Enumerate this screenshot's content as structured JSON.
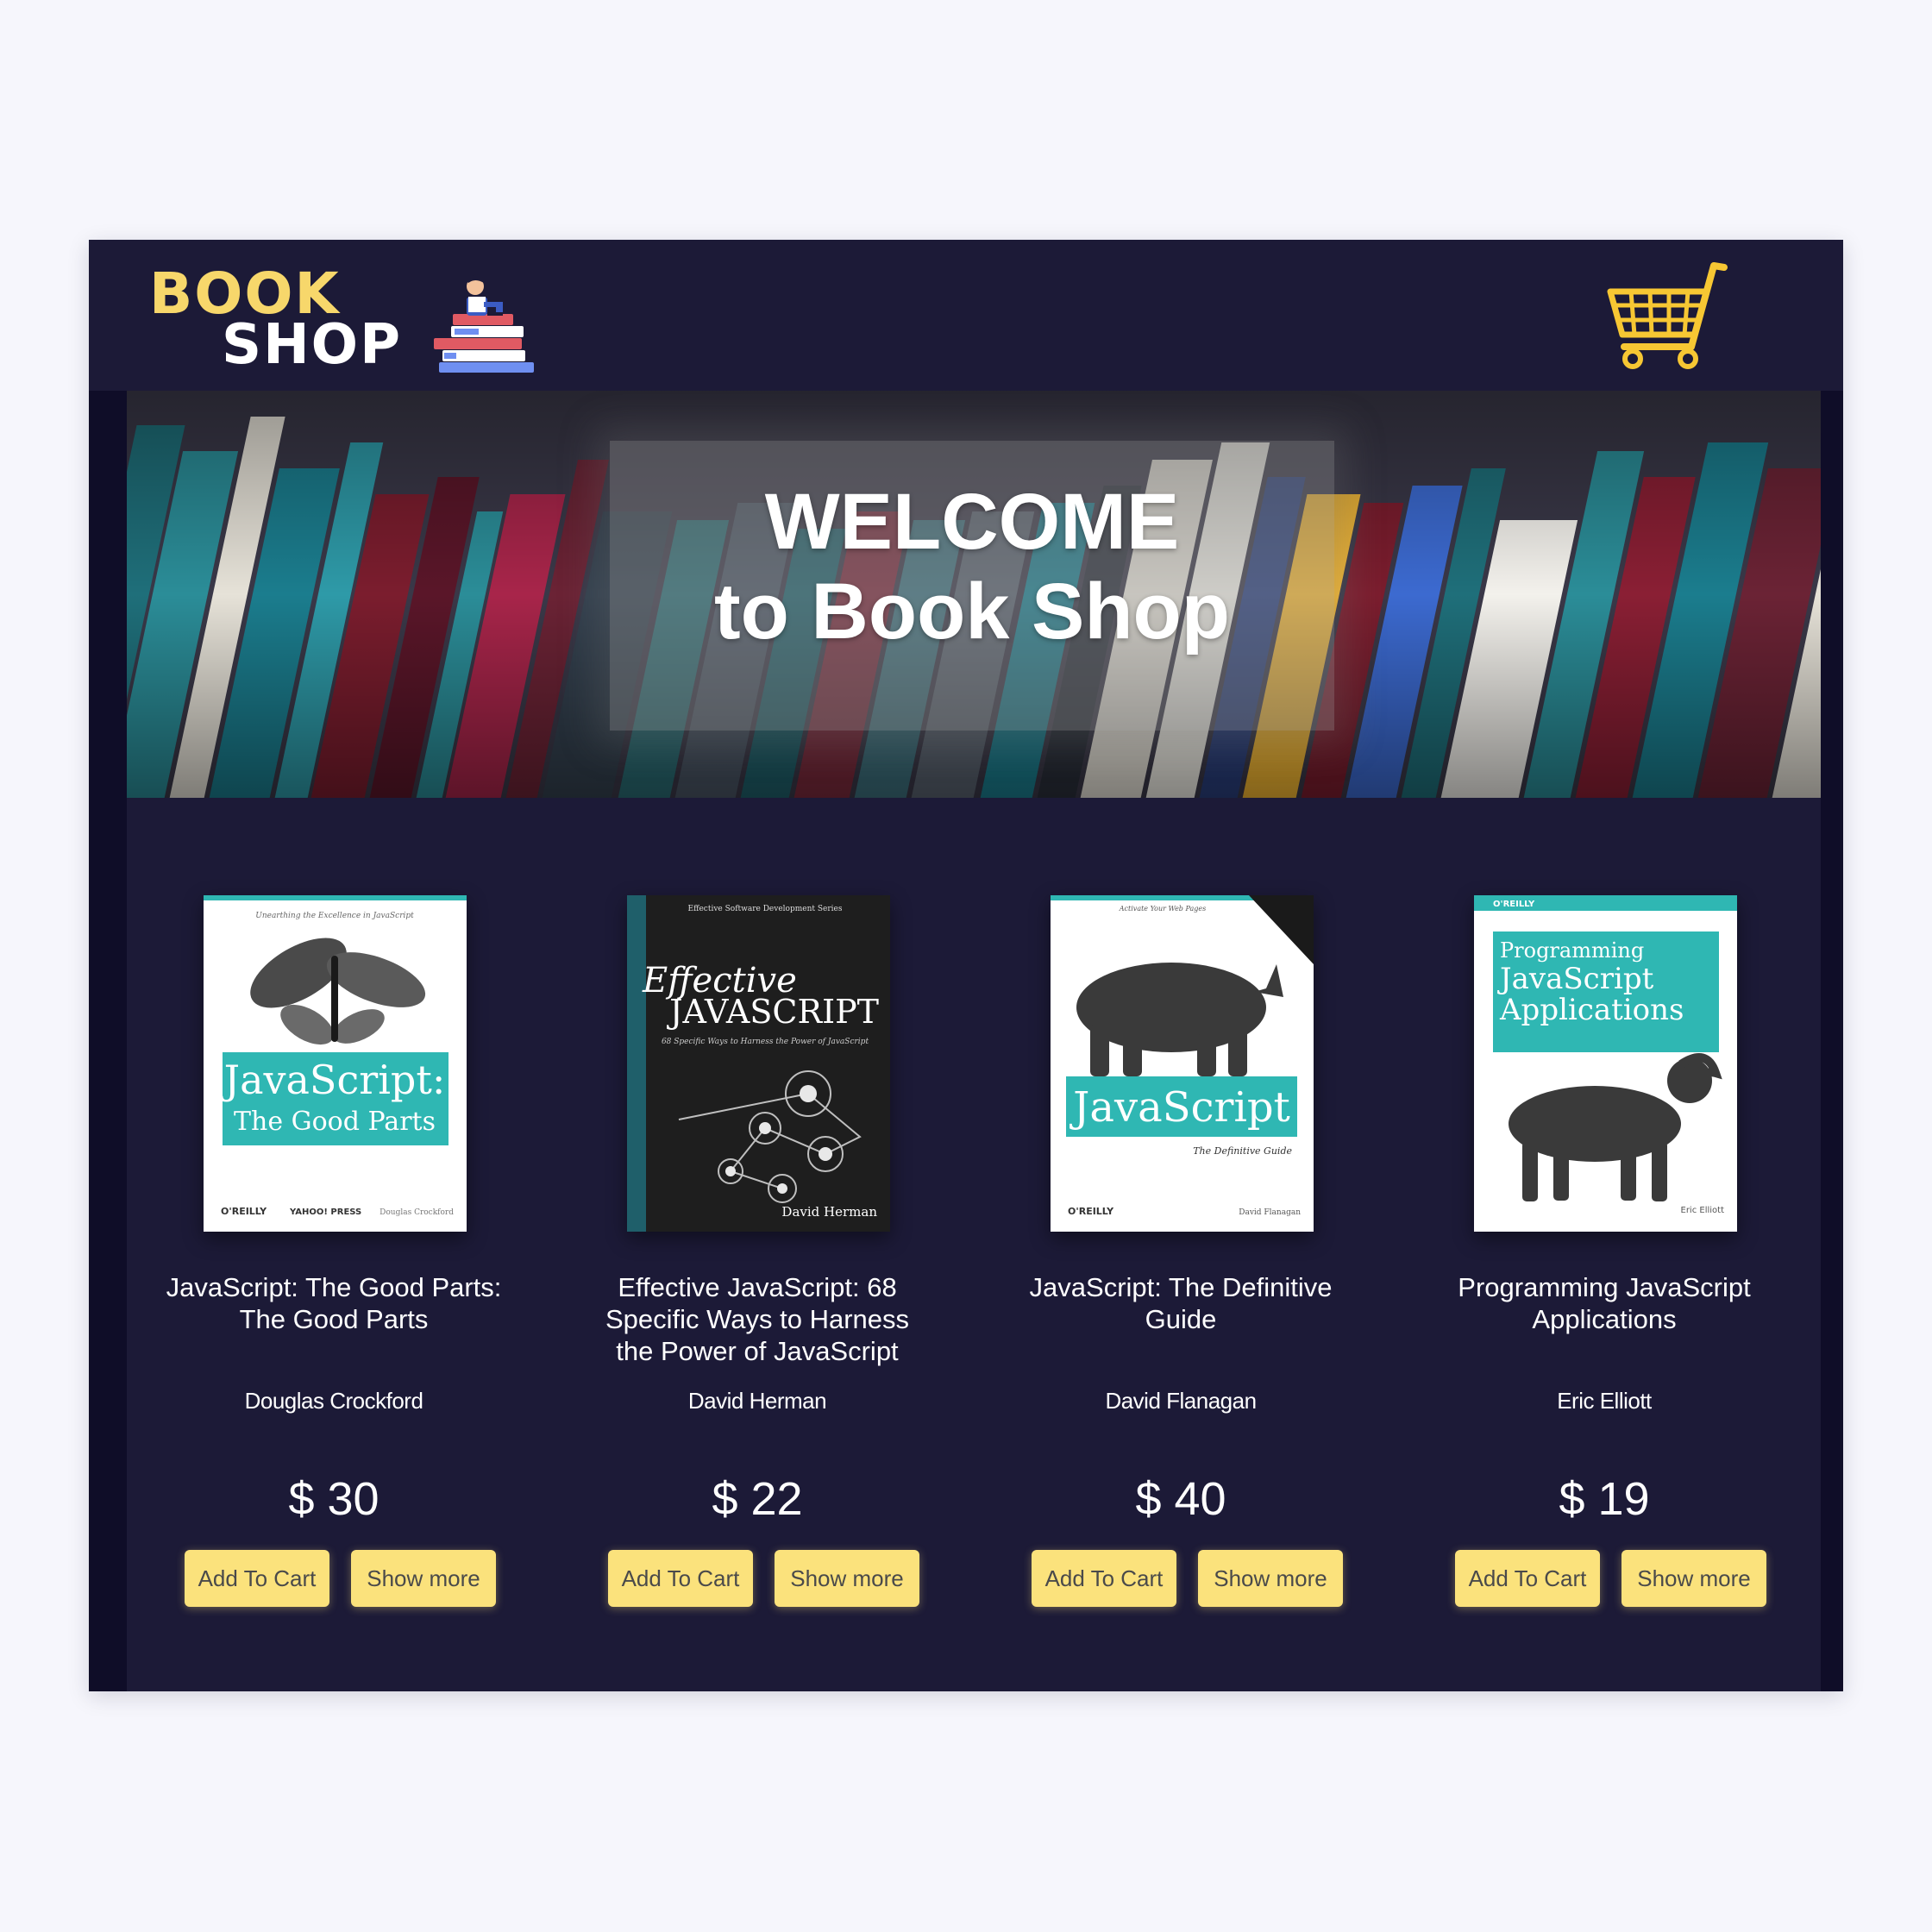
{
  "header": {
    "logo_top": "BOOK",
    "logo_bottom": "SHOP",
    "cart_icon": "shopping-cart-icon"
  },
  "hero": {
    "title_line1": "WELCOME",
    "title_line2": "to Book Shop"
  },
  "products": [
    {
      "title": "JavaScript: The Good Parts: The Good Parts",
      "author": "Douglas Crockford",
      "price": "$ 30",
      "add_label": "Add To Cart",
      "more_label": "Show more",
      "cover": {
        "series_text": "Unearthing the Excellence in JavaScript",
        "title_line1": "JavaScript:",
        "title_line2": "The Good Parts",
        "publisher": "O'REILLY",
        "imprint": "YAHOO! PRESS",
        "author": "Douglas Crockford"
      }
    },
    {
      "title": "Effective JavaScript: 68 Specific Ways to Harness the Power of JavaScript",
      "author": "David Herman",
      "price": "$ 22",
      "add_label": "Add To Cart",
      "more_label": "Show more",
      "cover": {
        "series_text": "Effective Software Development Series",
        "title_line1": "Effective",
        "title_line2": "JAVASCRIPT",
        "subtitle": "68 Specific Ways to Harness the Power of JavaScript",
        "author": "David Herman"
      }
    },
    {
      "title": "JavaScript: The Definitive Guide",
      "author": "David Flanagan",
      "price": "$ 40",
      "add_label": "Add To Cart",
      "more_label": "Show more",
      "cover": {
        "series_text": "Activate Your Web Pages",
        "title_line1": "JavaScript",
        "subtitle": "The Definitive Guide",
        "publisher": "O'REILLY",
        "author": "David Flanagan"
      }
    },
    {
      "title": "Programming JavaScript Applications",
      "author": "Eric Elliott",
      "price": "$ 19",
      "add_label": "Add To Cart",
      "more_label": "Show more",
      "cover": {
        "publisher": "O'REILLY",
        "title_line1": "Programming",
        "title_line2": "JavaScript",
        "title_line3": "Applications",
        "author": "Eric Elliott"
      }
    }
  ],
  "colors": {
    "page_bg": "#f6f6fc",
    "app_bg": "#1c1a37",
    "accent_yellow": "#fbe27c",
    "teal": "#2fb7b3"
  }
}
